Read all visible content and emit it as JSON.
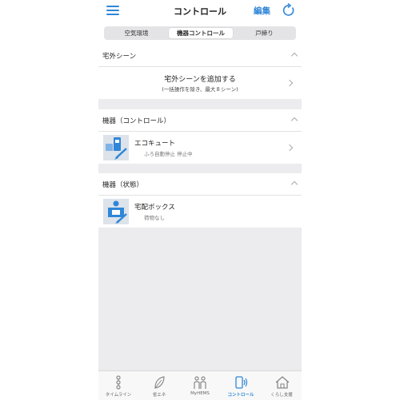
{
  "navbar": {
    "title": "コントロール",
    "edit_label": "編集"
  },
  "segments": [
    {
      "label": "空気環境"
    },
    {
      "label": "機器コントロール"
    },
    {
      "label": "戸締り"
    }
  ],
  "sections": {
    "outdoor": {
      "title": "宅外シーン",
      "add_label": "宅外シーンを追加する",
      "add_sublabel": "(一括操作を除き、最大８シーン)"
    },
    "control": {
      "title": "機器（コントロール）",
      "device_name": "エコキュート",
      "device_status": "ふろ自動停止 停止中"
    },
    "state": {
      "title": "機器（状態）",
      "device_name": "宅配ボックス",
      "device_status": "荷物なし"
    }
  },
  "tabs": [
    {
      "label": "タイムライン",
      "icon": "timeline-icon"
    },
    {
      "label": "省エネ",
      "icon": "leaf-icon"
    },
    {
      "label": "MyHEMS",
      "icon": "family-icon"
    },
    {
      "label": "コントロール",
      "icon": "phone-signal-icon"
    },
    {
      "label": "くらし支援",
      "icon": "house-icon"
    }
  ],
  "colors": {
    "accent": "#2f86d8",
    "background": "#ececee"
  }
}
